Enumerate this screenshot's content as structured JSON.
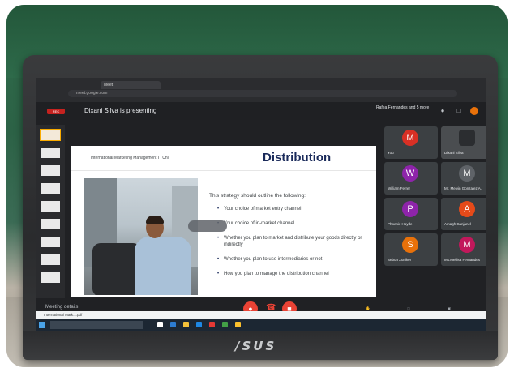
{
  "meet": {
    "presenting": "Dixani Silva is presenting",
    "participants_header": "Rafea Fernandes and 5 more",
    "meeting_details": "Meeting details"
  },
  "slide": {
    "course": "International Marketing Management I | Uni",
    "title": "Distribution",
    "intro": "This strategy should outline the following:",
    "bullets": [
      "Your choice of market entry channel",
      "Your choice of in-market channel",
      "Whether you plan to market and distribute your goods directly or indirectly",
      "Whether you plan to use intermediaries or not",
      "How you plan to manage the distribution channel"
    ]
  },
  "participants": [
    {
      "initial": "M",
      "name": "You",
      "color": "#d93025"
    },
    {
      "initial": "",
      "name": "Dixani Silva",
      "color": "#3c4043"
    },
    {
      "initial": "W",
      "name": "William Ferrer",
      "color": "#8e24aa"
    },
    {
      "initial": "M",
      "name": "Mr. Melvin Gonzalez A.",
      "color": "#5f6368"
    },
    {
      "initial": "P",
      "name": "Phoenix Hayde",
      "color": "#8e24aa"
    },
    {
      "initial": "A",
      "name": "Amagh Sanjanel",
      "color": "#e64a19"
    },
    {
      "initial": "S",
      "name": "Sebon Zuniker",
      "color": "#e8710a"
    },
    {
      "initial": "M",
      "name": "Ms.Mellisa Fernandes",
      "color": "#c2185b"
    }
  ],
  "brand": "/SUS",
  "taskbar": {
    "download": "International Mark....pdf"
  }
}
